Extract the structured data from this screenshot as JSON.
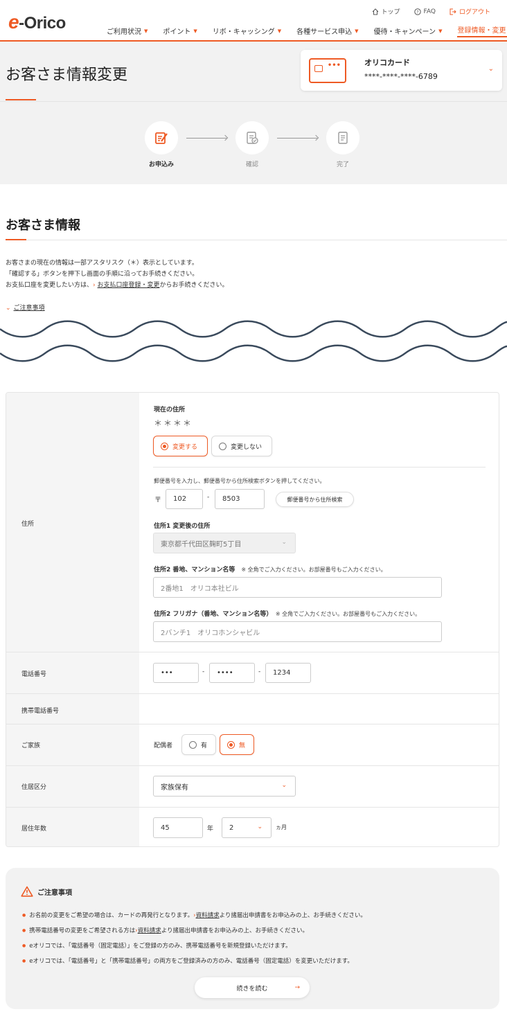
{
  "header": {
    "logo_e": "e",
    "logo_rest": "-Orico",
    "top_links": [
      {
        "label": "トップ",
        "icon": "home-icon"
      },
      {
        "label": "FAQ",
        "icon": "help-icon"
      },
      {
        "label": "ログアウト",
        "icon": "logout-icon"
      }
    ],
    "nav": [
      {
        "label": "ご利用状況"
      },
      {
        "label": "ポイント"
      },
      {
        "label": "リボ・キャッシング"
      },
      {
        "label": "各種サービス申込"
      },
      {
        "label": "優待・キャンペーン"
      },
      {
        "label": "登録情報・変更"
      }
    ]
  },
  "page": {
    "title": "お客さま情報変更",
    "card_name": "オリコカード",
    "card_number": "****-****-****-6789",
    "card_dots": "•••"
  },
  "steps": [
    {
      "label": "お申込み"
    },
    {
      "label": "確認"
    },
    {
      "label": "完了"
    }
  ],
  "section": {
    "title": "お客さま情報",
    "intro1": "お客さまの現在の情報は一部アスタリスク（＊）表示としています。",
    "intro2": "「確認する」ボタンを押下し画面の手順に沿ってお手続きください。",
    "intro3a": "お支払口座を変更したい方は、",
    "intro3_link": "お支払口座登録・変更",
    "intro3b": "からお手続きください。",
    "caution_toggle": "ご注意事項"
  },
  "form": {
    "address": {
      "label": "住所",
      "current_label": "現在の住所",
      "current_value": "＊＊＊＊",
      "change": "変更する",
      "no_change": "変更しない",
      "zip_hint": "郵便番号を入力し、郵便番号から住所検索ボタンを押してください。",
      "zip_mark": "〒",
      "zip1": "102",
      "zip_dash": "-",
      "zip2": "8503",
      "zip_search": "郵便番号から住所検索",
      "addr1_label": "住所1 変更後の住所",
      "addr1_value": "東京都千代田区麹町5丁目",
      "addr2_label": "住所2 番地、マンション名等",
      "addr2_note": "※ 全角でご入力ください。お部屋番号もご入力ください。",
      "addr2_value": "2番地1　オリコ本社ビル",
      "addr2k_label": "住所2 フリガナ（番地、マンション名等）",
      "addr2k_note": "※ 全角でご入力ください。お部屋番号もご入力ください。",
      "addr2k_value": "2バンチ1　オリコホンシャビル"
    },
    "phone": {
      "label": "電話番号",
      "p1": "•••",
      "p2": "••••",
      "p3": "1234",
      "dash": "-"
    },
    "mobile": {
      "label": "携帯電話番号"
    },
    "family": {
      "label": "ご家族",
      "spouse_label": "配偶者",
      "yes": "有",
      "no": "無"
    },
    "residence": {
      "label": "住居区分",
      "value": "家族保有"
    },
    "years": {
      "label": "居住年数",
      "years_value": "45",
      "years_unit": "年",
      "months_value": "2",
      "months_unit": "ヵ月"
    }
  },
  "notes": {
    "title": "ご注意事項",
    "n1a": "お名前の変更をご希望の場合は、カードの再発行となります。",
    "n1_link": "資料請求",
    "n1b": "より諸届出申請書をお申込みの上、お手続きください。",
    "n2a": "携帯電話番号の変更をご希望される方は",
    "n2_link": "資料請求",
    "n2b": "より諸届出申請書をお申込みの上、お手続きください。",
    "n3": "eオリコでは、「電話番号（固定電話）」をご登録の方のみ、携帯電話番号を新規登録いただけます。",
    "n4": "eオリコでは、「電話番号」と「携帯電話番号」の両方をご登録済みの方のみ、電話番号（固定電話）を変更いただけます。",
    "read_more": "続きを読む",
    "read_more_arrow": "→"
  }
}
